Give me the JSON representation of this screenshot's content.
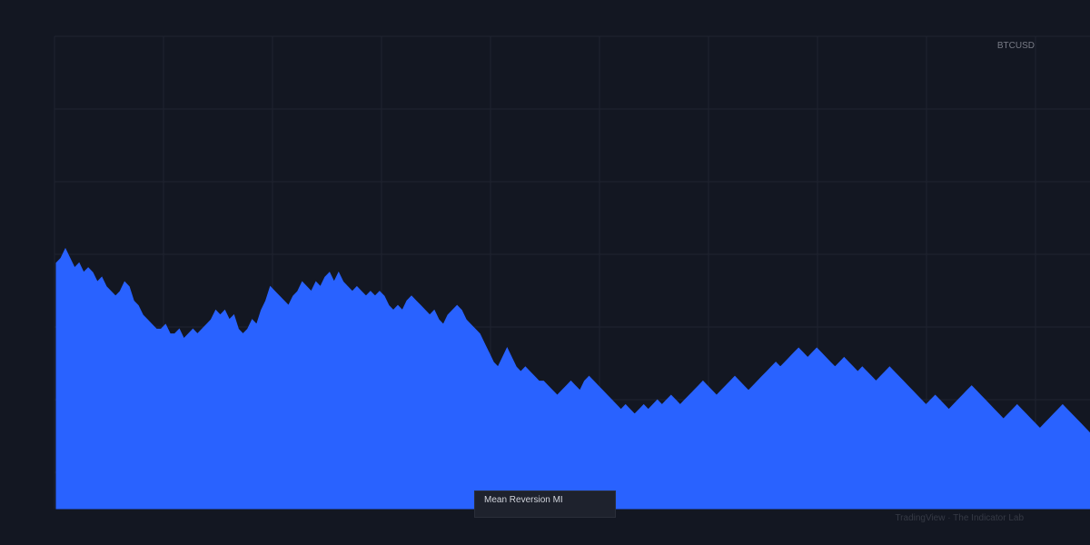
{
  "chart_data": {
    "type": "area",
    "symbol": "BTCUSD",
    "indicator_name": "Mean Reversion MI",
    "attribution": "TradingView · The Indicator Lab",
    "grid": true,
    "legend": "none",
    "ylim": [
      0,
      1
    ],
    "x": [
      0,
      1,
      2,
      3,
      4,
      5,
      6,
      7,
      8,
      9,
      10,
      11,
      12,
      13,
      14,
      15,
      16,
      17,
      18,
      19,
      20,
      21,
      22,
      23,
      24,
      25,
      26,
      27,
      28,
      29,
      30,
      31,
      32,
      33,
      34,
      35,
      36,
      37,
      38,
      39,
      40,
      41,
      42,
      43,
      44,
      45,
      46,
      47,
      48,
      49,
      50,
      51,
      52,
      53,
      54,
      55,
      56,
      57,
      58,
      59,
      60,
      61,
      62,
      63,
      64,
      65,
      66,
      67,
      68,
      69,
      70,
      71,
      72,
      73,
      74,
      75,
      76,
      77,
      78,
      79,
      80,
      81,
      82,
      83,
      84,
      85,
      86,
      87,
      88,
      89,
      90,
      91,
      92,
      93,
      94,
      95,
      96,
      97,
      98,
      99,
      100,
      101,
      102,
      103,
      104,
      105,
      106,
      107,
      108,
      109,
      110,
      111,
      112,
      113,
      114,
      115,
      116,
      117,
      118,
      119,
      120,
      121,
      122,
      123,
      124,
      125,
      126,
      127,
      128,
      129,
      130,
      131,
      132,
      133,
      134,
      135,
      136,
      137,
      138,
      139,
      140,
      141,
      142,
      143,
      144,
      145,
      146,
      147,
      148,
      149,
      150,
      151,
      152,
      153,
      154,
      155,
      156,
      157,
      158,
      159,
      160,
      161,
      162,
      163,
      164,
      165,
      166,
      167,
      168,
      169,
      170,
      171,
      172,
      173,
      174,
      175,
      176,
      177,
      178,
      179,
      180,
      181,
      182,
      183,
      184,
      185,
      186,
      187,
      188,
      189,
      190,
      191,
      192,
      193,
      194,
      195,
      196,
      197,
      198,
      199,
      200,
      201,
      202,
      203,
      204,
      205,
      206,
      207,
      208,
      209,
      210,
      211,
      212,
      213,
      214,
      215,
      216,
      217,
      218,
      219,
      220,
      221,
      222,
      223,
      224,
      225,
      226,
      227
    ],
    "values": [
      0.52,
      0.53,
      0.55,
      0.53,
      0.51,
      0.52,
      0.5,
      0.51,
      0.5,
      0.48,
      0.49,
      0.47,
      0.46,
      0.45,
      0.46,
      0.48,
      0.47,
      0.44,
      0.43,
      0.41,
      0.4,
      0.39,
      0.38,
      0.38,
      0.39,
      0.37,
      0.37,
      0.38,
      0.36,
      0.37,
      0.38,
      0.37,
      0.38,
      0.39,
      0.4,
      0.42,
      0.41,
      0.42,
      0.4,
      0.41,
      0.38,
      0.37,
      0.38,
      0.4,
      0.39,
      0.42,
      0.44,
      0.47,
      0.46,
      0.45,
      0.44,
      0.43,
      0.45,
      0.46,
      0.48,
      0.47,
      0.46,
      0.48,
      0.47,
      0.49,
      0.5,
      0.48,
      0.5,
      0.48,
      0.47,
      0.46,
      0.47,
      0.46,
      0.45,
      0.46,
      0.45,
      0.46,
      0.45,
      0.43,
      0.42,
      0.43,
      0.42,
      0.44,
      0.45,
      0.44,
      0.43,
      0.42,
      0.41,
      0.42,
      0.4,
      0.39,
      0.41,
      0.42,
      0.43,
      0.42,
      0.4,
      0.39,
      0.38,
      0.37,
      0.35,
      0.33,
      0.31,
      0.3,
      0.32,
      0.34,
      0.32,
      0.3,
      0.29,
      0.3,
      0.29,
      0.28,
      0.27,
      0.27,
      0.26,
      0.25,
      0.24,
      0.25,
      0.26,
      0.27,
      0.26,
      0.25,
      0.27,
      0.28,
      0.27,
      0.26,
      0.25,
      0.24,
      0.23,
      0.22,
      0.21,
      0.22,
      0.21,
      0.2,
      0.21,
      0.22,
      0.21,
      0.22,
      0.23,
      0.22,
      0.23,
      0.24,
      0.23,
      0.22,
      0.23,
      0.24,
      0.25,
      0.26,
      0.27,
      0.26,
      0.25,
      0.24,
      0.25,
      0.26,
      0.27,
      0.28,
      0.27,
      0.26,
      0.25,
      0.26,
      0.27,
      0.28,
      0.29,
      0.3,
      0.31,
      0.3,
      0.31,
      0.32,
      0.33,
      0.34,
      0.33,
      0.32,
      0.33,
      0.34,
      0.33,
      0.32,
      0.31,
      0.3,
      0.31,
      0.32,
      0.31,
      0.3,
      0.29,
      0.3,
      0.29,
      0.28,
      0.27,
      0.28,
      0.29,
      0.3,
      0.29,
      0.28,
      0.27,
      0.26,
      0.25,
      0.24,
      0.23,
      0.22,
      0.23,
      0.24,
      0.23,
      0.22,
      0.21,
      0.22,
      0.23,
      0.24,
      0.25,
      0.26,
      0.25,
      0.24,
      0.23,
      0.22,
      0.21,
      0.2,
      0.19,
      0.2,
      0.21,
      0.22,
      0.21,
      0.2,
      0.19,
      0.18,
      0.17,
      0.18,
      0.19,
      0.2,
      0.21,
      0.22,
      0.21,
      0.2,
      0.19,
      0.18,
      0.17,
      0.16,
      0.15,
      0.16
    ],
    "colors": {
      "background": "#131722",
      "grid": "#1f2330",
      "area": "#2962ff",
      "text": "#787b86"
    }
  }
}
